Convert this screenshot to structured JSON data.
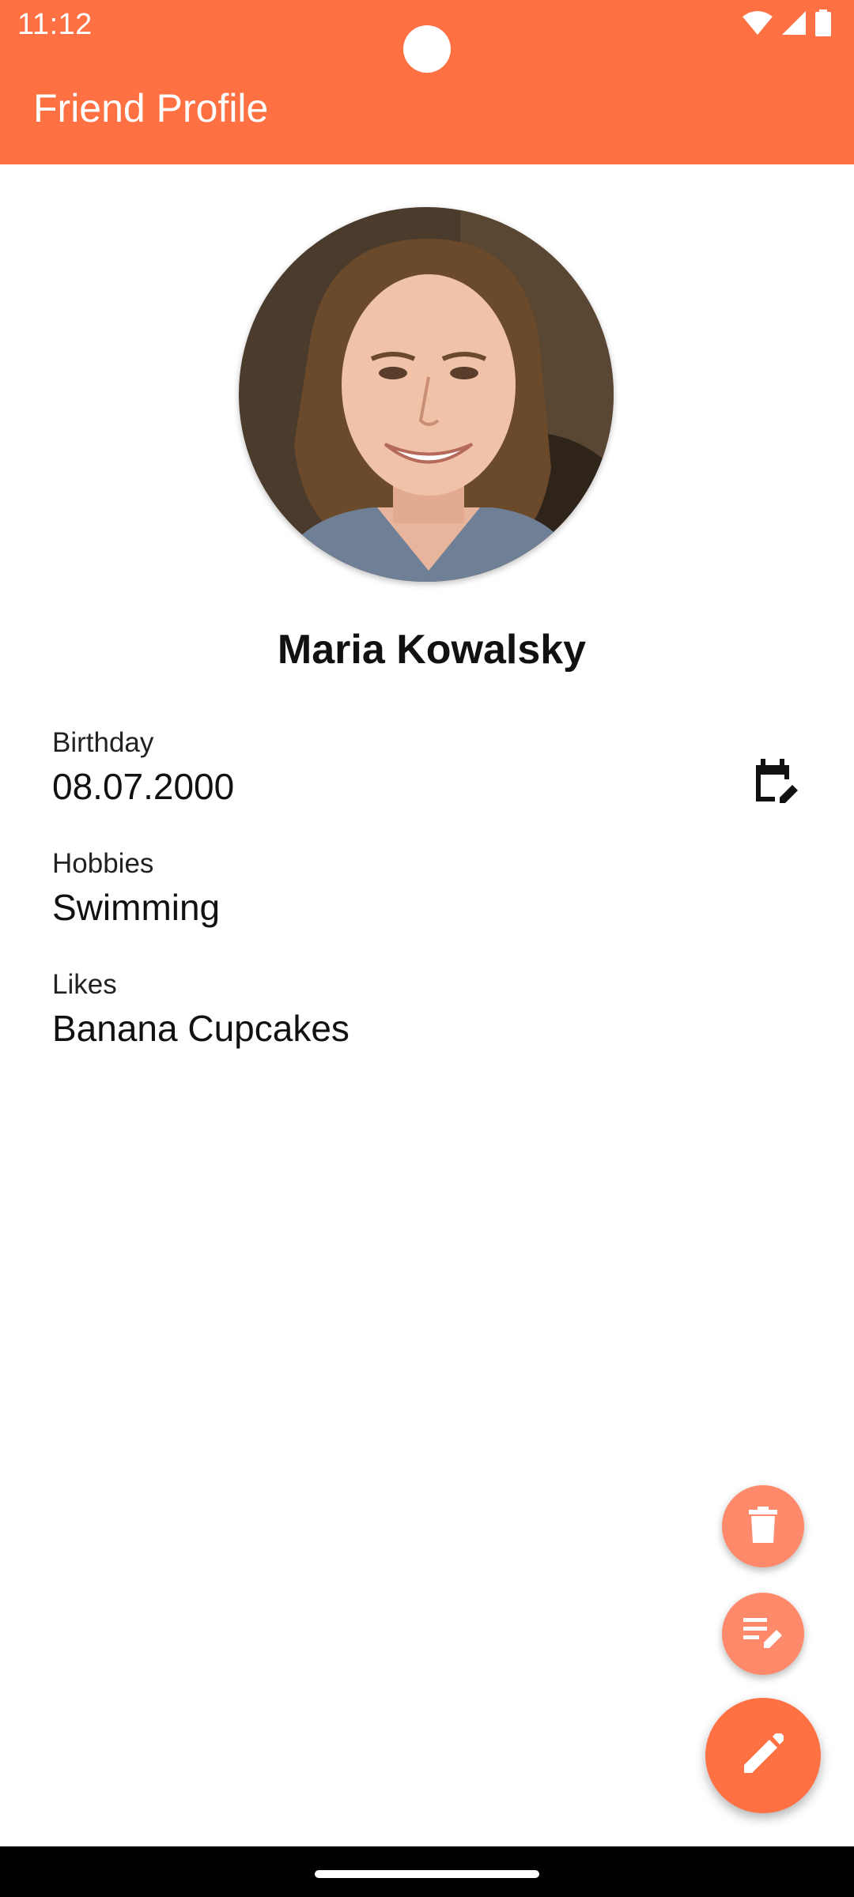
{
  "status_bar": {
    "time": "11:12",
    "icons": [
      "wifi-icon",
      "signal-icon",
      "battery-icon"
    ]
  },
  "app_bar": {
    "title": "Friend Profile",
    "color": "#FF7043"
  },
  "profile": {
    "name": "Maria Kowalsky",
    "photo": "avatar-photo"
  },
  "fields": {
    "birthday": {
      "label": "Birthday",
      "value": "08.07.2000"
    },
    "hobbies": {
      "label": "Hobbies",
      "value": "Swimming"
    },
    "likes": {
      "label": "Likes",
      "value": "Banana Cupcakes"
    }
  },
  "actions": {
    "birthday_edit_icon": "calendar-edit-icon",
    "delete_icon": "trash-icon",
    "edit_notes_icon": "edit-note-icon",
    "edit_icon": "pencil-icon",
    "fab_color": "#FF7043",
    "fab_small_color": "#FF8A6B"
  }
}
